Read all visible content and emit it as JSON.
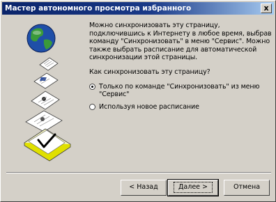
{
  "window": {
    "title": "Мастер автономного просмотра избранного",
    "close_glyph": "x"
  },
  "content": {
    "description": "Можно синхронизовать эту страницу, подключившись к Интернету в любое время, выбрав команду \"Синхронизовать\" в меню \"Сервис\". Можно также выбрать расписание для автоматической синхронизации этой страницы.",
    "question": "Как синхронизовать эту страницу?",
    "options": [
      {
        "label": "Только по команде \"Синхронизовать\" из меню \"Сервис\"",
        "selected": true
      },
      {
        "label": "Используя новое расписание",
        "selected": false
      }
    ]
  },
  "buttons": {
    "back": "< Назад",
    "next": "Далее >",
    "cancel": "Отмена"
  },
  "icons": [
    "globe-icon",
    "document-stack-icon",
    "checkmark-icon",
    "close-icon"
  ],
  "colors": {
    "titlebar_start": "#0a246a",
    "titlebar_end": "#a6caf0",
    "dialog_bg": "#d4d0c8",
    "globe_water": "#1f4fa8",
    "globe_land": "#3a9a3a",
    "doc_accent": "#e0e000"
  }
}
